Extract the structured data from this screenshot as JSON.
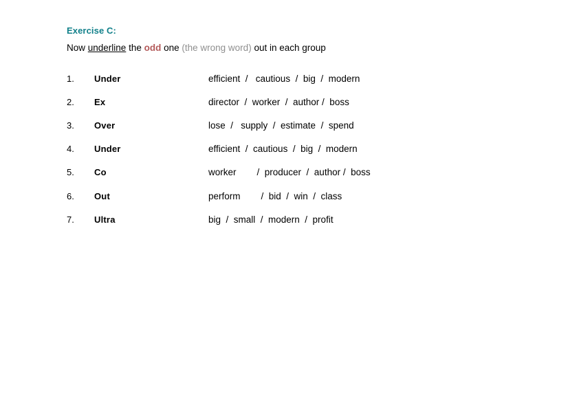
{
  "document": {
    "title": "Exercise C:",
    "instruction": {
      "lead": "Now ",
      "underlined": "underline",
      "mid": " the ",
      "odd": "odd",
      "post": " one ",
      "paren_open": "(",
      "paren_text": "the wrong word",
      "paren_close": ")",
      "tail": " out in each group"
    },
    "accent_color": "#11808a",
    "odd_color": "#b35a5a",
    "paren_color": "#8f8f8f",
    "rows": [
      {
        "num": "1.",
        "prefix": "Under",
        "options": "efficient  /   cautious  /  big  /  modern"
      },
      {
        "num": "2.",
        "prefix": "Ex",
        "options": "director  /  worker  /  author /  boss"
      },
      {
        "num": "3.",
        "prefix": "Over",
        "options": "lose  /   supply  /  estimate  /  spend"
      },
      {
        "num": "4.",
        "prefix": "Under",
        "options": "efficient  /  cautious  /  big  /  modern"
      },
      {
        "num": "5.",
        "prefix": "Co",
        "options": "worker        /  producer  /  author /  boss"
      },
      {
        "num": "6.",
        "prefix": "Out",
        "options": "perform        /  bid  /  win  /  class"
      },
      {
        "num": "7.",
        "prefix": "Ultra",
        "options": "big  /  small  /  modern  /  profit"
      }
    ]
  }
}
